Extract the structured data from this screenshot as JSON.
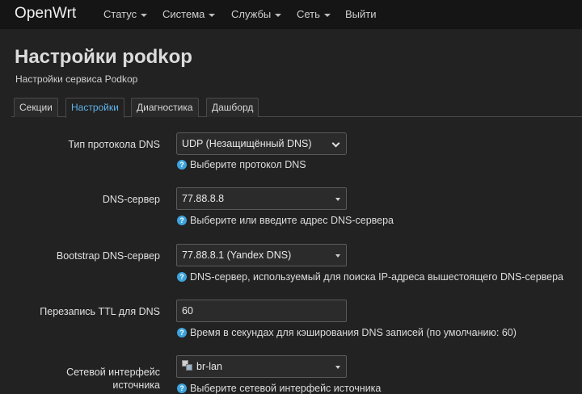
{
  "navbar": {
    "brand": "OpenWrt",
    "items": [
      {
        "label": "Статус",
        "dropdown": true
      },
      {
        "label": "Система",
        "dropdown": true
      },
      {
        "label": "Службы",
        "dropdown": true
      },
      {
        "label": "Сеть",
        "dropdown": true
      },
      {
        "label": "Выйти",
        "dropdown": false
      }
    ]
  },
  "page": {
    "title": "Настройки podkop",
    "subtitle": "Настройки сервиса Podkop"
  },
  "tabs": [
    {
      "label": "Секции",
      "active": false
    },
    {
      "label": "Настройки",
      "active": true
    },
    {
      "label": "Диагностика",
      "active": false
    },
    {
      "label": "Дашборд",
      "active": false
    }
  ],
  "form": {
    "dns_protocol": {
      "label": "Тип протокола DNS",
      "value": "UDP (Незащищённый DNS)",
      "hint": "Выберите протокол DNS"
    },
    "dns_server": {
      "label": "DNS-сервер",
      "value": "77.88.8.8",
      "hint": "Выберите или введите адрес DNS-сервера"
    },
    "bootstrap_dns": {
      "label": "Bootstrap DNS-сервер",
      "value": "77.88.8.1 (Yandex DNS)",
      "hint": "DNS-сервер, используемый для поиска IP-адреса вышестоящего DNS-сервера"
    },
    "dns_ttl": {
      "label": "Перезапись TTL для DNS",
      "value": "60",
      "hint": "Время в секундах для кэширования DNS записей (по умолчанию: 60)"
    },
    "source_iface": {
      "label_line1": "Сетевой интерфейс",
      "label_line2": "источника",
      "value": "br-lan",
      "hint": "Выберите сетевой интерфейс источника"
    }
  },
  "colors": {
    "background": "#222222",
    "navbar": "#151515",
    "active_tab": "#5fb3ea",
    "help_icon": "#3da3dc"
  },
  "icons": {
    "help": "help-circle-icon",
    "interface": "network-interface-icon",
    "dropdown": "chevron-down-icon"
  }
}
